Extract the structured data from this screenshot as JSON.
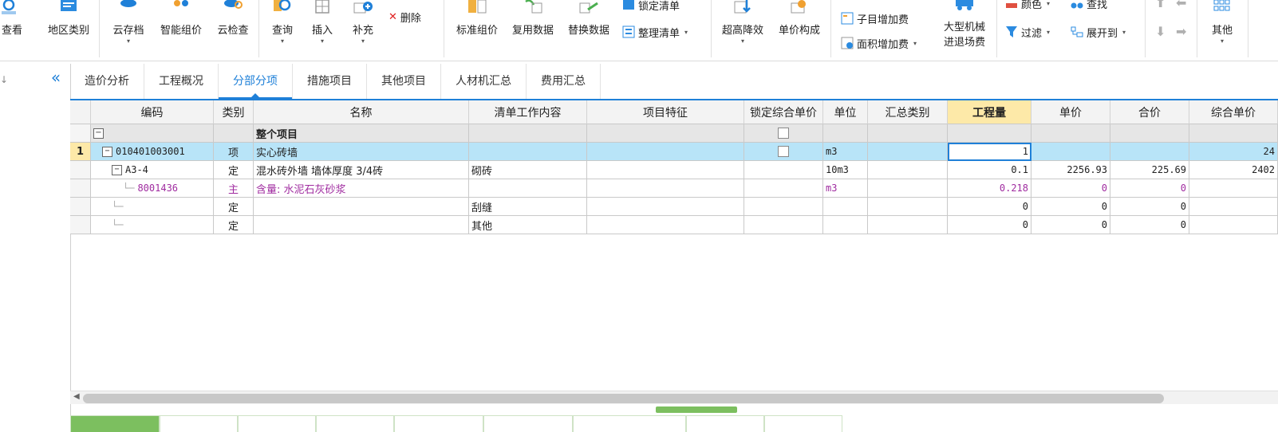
{
  "ribbon": {
    "items": [
      {
        "id": "view",
        "label": "查看",
        "icon": "magnifier-icon"
      },
      {
        "id": "region",
        "label": "地区类别",
        "icon": "region-icon"
      },
      {
        "id": "cloud_store",
        "label": "云存档",
        "icon": "cloud-save-icon",
        "dropdown": "▾"
      },
      {
        "id": "smart_price",
        "label": "智能组价",
        "icon": "smart-price-icon"
      },
      {
        "id": "cloud_check",
        "label": "云检查",
        "icon": "cloud-check-icon"
      },
      {
        "id": "query",
        "label": "查询",
        "icon": "query-icon",
        "dropdown": "▾"
      },
      {
        "id": "insert",
        "label": "插入",
        "icon": "insert-icon",
        "dropdown": "▾"
      },
      {
        "id": "supplement",
        "label": "补充",
        "icon": "supplement-icon",
        "dropdown": "▾"
      },
      {
        "id": "std_price",
        "label": "标准组价",
        "icon": "standard-price-icon"
      },
      {
        "id": "reuse",
        "label": "复用数据",
        "icon": "reuse-data-icon"
      },
      {
        "id": "replace",
        "label": "替换数据",
        "icon": "replace-data-icon"
      },
      {
        "id": "high_drop",
        "label": "超高降效",
        "icon": "high-efficiency-icon",
        "dropdown": "▾"
      },
      {
        "id": "unit_comp",
        "label": "单价构成",
        "icon": "unit-price-icon"
      },
      {
        "id": "machinery",
        "label": "大型机械\n进退场费",
        "icon": "machinery-icon"
      },
      {
        "id": "other",
        "label": "其他",
        "icon": "grid-icon",
        "dropdown": "▾"
      }
    ],
    "small_items": {
      "delete": "删除",
      "lock_list": "锁定清单",
      "organize": "整理清单",
      "sub_fee": "子目增加费",
      "area_fee": "面积增加费",
      "color": "颜色",
      "find": "查找",
      "filter": "过滤",
      "expand": "展开到"
    },
    "dropdown_glyph": "▾"
  },
  "sidebar": {
    "collapse_glyph": "«",
    "left_arrow": "↓"
  },
  "tabs": [
    "造价分析",
    "工程概况",
    "分部分项",
    "措施项目",
    "其他项目",
    "人材机汇总",
    "费用汇总"
  ],
  "active_tab": "分部分项",
  "grid": {
    "columns": [
      "编码",
      "类别",
      "名称",
      "清单工作内容",
      "项目特征",
      "锁定综合单价",
      "单位",
      "汇总类别",
      "工程量",
      "单价",
      "合价",
      "综合单价"
    ],
    "rows": [
      {
        "index": "",
        "code": "",
        "type": "",
        "name": "整个项目",
        "work": "",
        "feature": "",
        "lock": true,
        "unit": "",
        "sum_cat": "",
        "qty": "",
        "price": "",
        "total": "",
        "comp": "",
        "toggle": "−"
      },
      {
        "index": "1",
        "code": "010401003001",
        "type": "项",
        "name": "实心砖墙",
        "work": "",
        "feature": "",
        "lock": true,
        "unit": "m3",
        "sum_cat": "",
        "qty": "1",
        "price": "",
        "total": "",
        "comp": "24",
        "toggle": "−"
      },
      {
        "index": "",
        "code": "A3-4",
        "type": "定",
        "name": "混水砖外墙 墙体厚度 3/4砖",
        "work": "砌砖",
        "feature": "",
        "lock": false,
        "unit": "10m3",
        "sum_cat": "",
        "qty": "0.1",
        "price": "2256.93",
        "total": "225.69",
        "comp": "2402",
        "toggle": "−"
      },
      {
        "index": "",
        "code": "8001436",
        "type": "主",
        "name": "含量: 水泥石灰砂浆",
        "work": "",
        "feature": "",
        "lock": false,
        "unit": "m3",
        "sum_cat": "",
        "qty": "0.218",
        "price": "0",
        "total": "0",
        "comp": ""
      },
      {
        "index": "",
        "code": "",
        "type": "定",
        "name": "",
        "work": "刮缝",
        "feature": "",
        "lock": false,
        "unit": "",
        "sum_cat": "",
        "qty": "0",
        "price": "0",
        "total": "0",
        "comp": ""
      },
      {
        "index": "",
        "code": "",
        "type": "定",
        "name": "",
        "work": "其他",
        "feature": "",
        "lock": false,
        "unit": "",
        "sum_cat": "",
        "qty": "0",
        "price": "0",
        "total": "0",
        "comp": ""
      }
    ]
  },
  "scrollbar": {
    "left_glyph": "◀"
  },
  "colors": {
    "accent": "#1f80d8",
    "selected_row": "#b8e4f8",
    "header_highlight": "#fde9a8",
    "material_text": "#a02ca0",
    "bottom_tab": "#7cbf5f"
  }
}
